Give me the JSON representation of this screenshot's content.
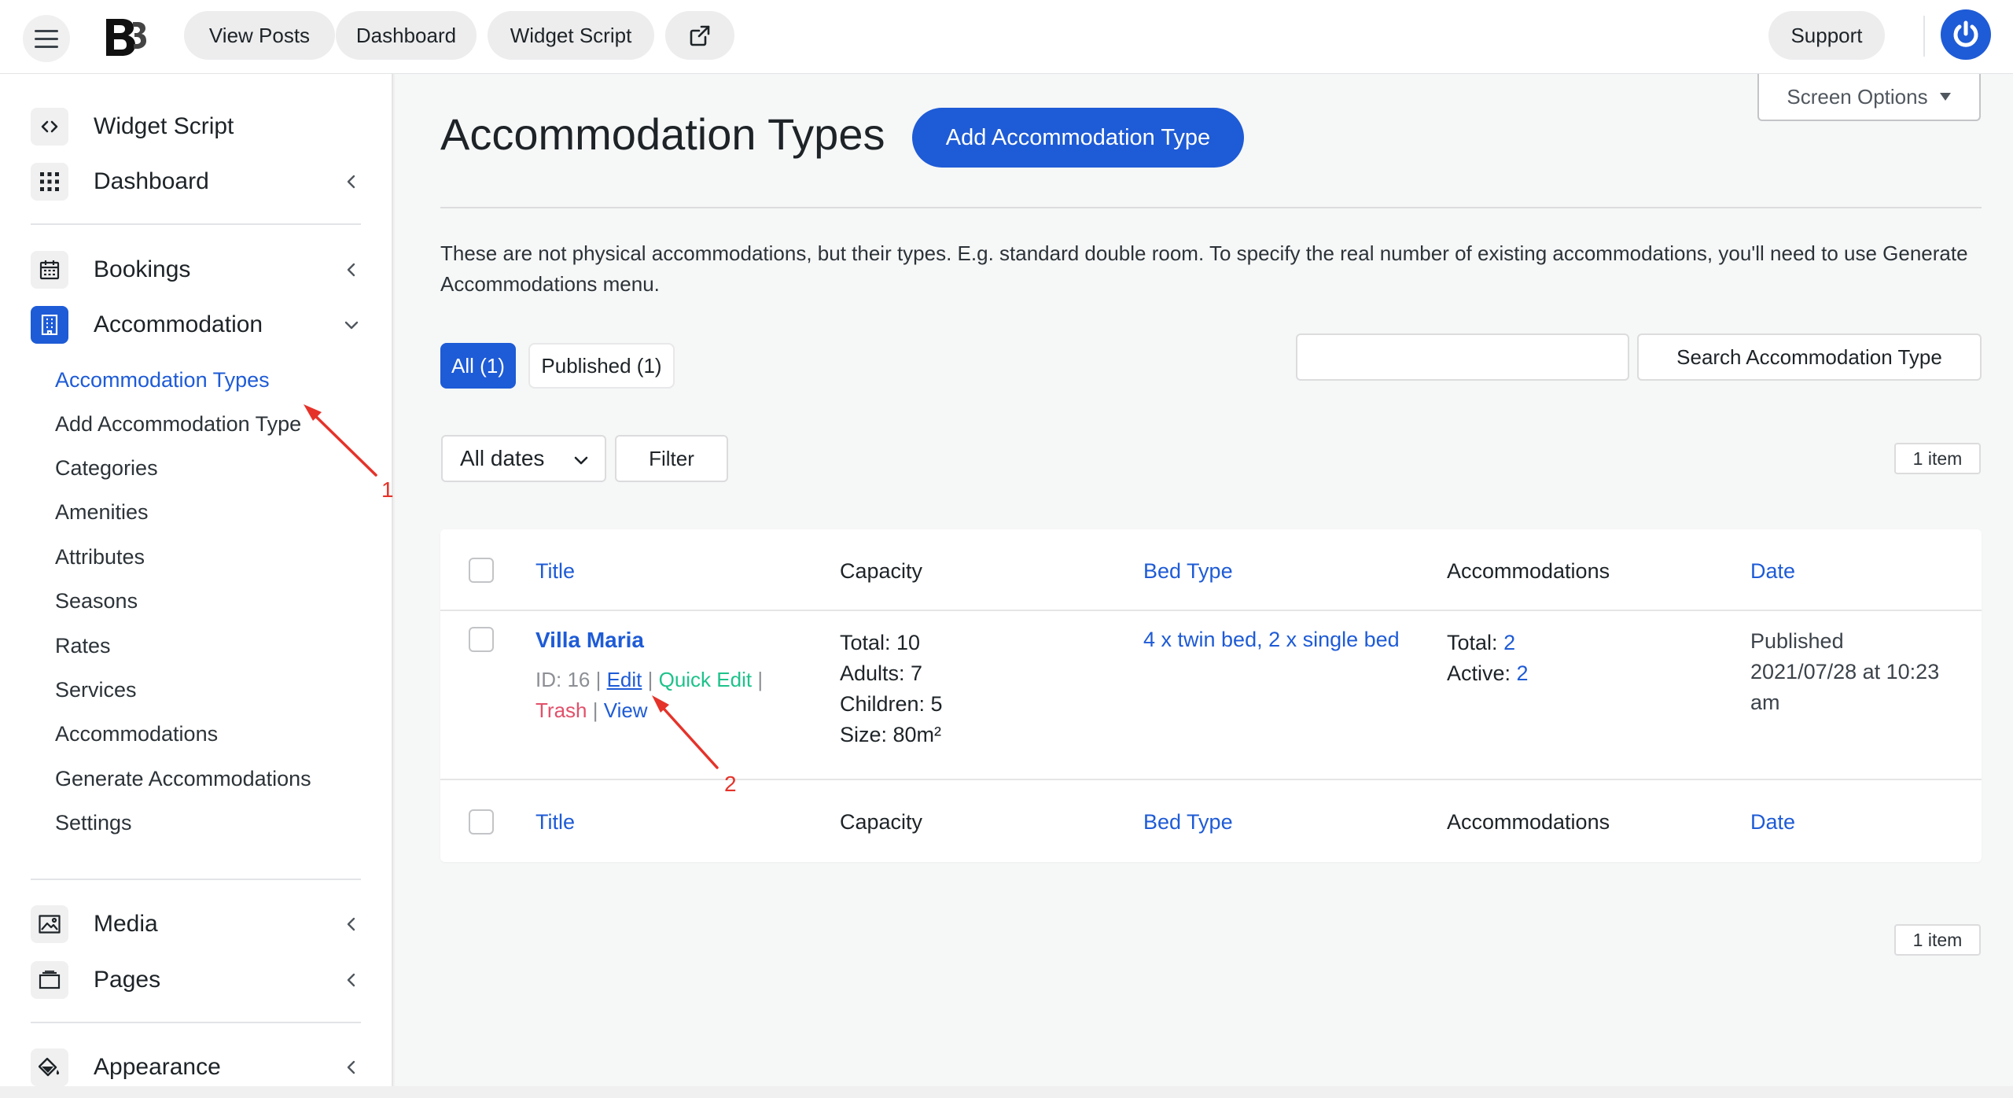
{
  "topbar": {
    "view_posts": "View Posts",
    "dashboard": "Dashboard",
    "widget_script": "Widget Script",
    "support": "Support",
    "accent_color": "#1e5bd6"
  },
  "sidebar": {
    "items": [
      {
        "label": "Widget Script",
        "icon": "code-icon"
      },
      {
        "label": "Dashboard",
        "icon": "grid-icon"
      },
      {
        "label": "Bookings",
        "icon": "calendar-icon"
      },
      {
        "label": "Accommodation",
        "icon": "building-icon"
      },
      {
        "label": "Media",
        "icon": "image-icon"
      },
      {
        "label": "Pages",
        "icon": "pages-icon"
      },
      {
        "label": "Appearance",
        "icon": "paint-bucket-icon"
      }
    ],
    "submenu": [
      "Accommodation Types",
      "Add Accommodation Type",
      "Categories",
      "Amenities",
      "Attributes",
      "Seasons",
      "Rates",
      "Services",
      "Accommodations",
      "Generate Accommodations",
      "Settings"
    ]
  },
  "main": {
    "screen_options": "Screen Options",
    "title": "Accommodation Types",
    "add_button": "Add Accommodation Type",
    "description": "These are not physical accommodations, but their types. E.g. standard double room. To specify the real number of existing accommodations, you'll need to use Generate Accommodations menu.",
    "tabs": {
      "all": "All (1)",
      "published": "Published (1)"
    },
    "search": {
      "placeholder": "",
      "button": "Search Accommodation Type"
    },
    "dates_select": "All dates",
    "filter_button": "Filter",
    "items_count": "1 item"
  },
  "table": {
    "columns": [
      "Title",
      "Capacity",
      "Bed Type",
      "Accommodations",
      "Date"
    ],
    "rows": [
      {
        "title": "Villa Maria",
        "id_label": "ID: 16",
        "actions": {
          "edit": "Edit",
          "quick_edit": "Quick Edit",
          "trash": "Trash",
          "view": "View"
        },
        "capacity": [
          "Total: 10",
          "Adults: 7",
          "Children: 5",
          "Size:  80m²"
        ],
        "bed_type": "4 x twin bed, 2 x single bed",
        "accommodations": {
          "total_label": "Total:",
          "total_value": "2",
          "active_label": "Active:",
          "active_value": "2"
        },
        "date": [
          "Published",
          "2021/07/28 at 10:23",
          "am"
        ]
      }
    ]
  },
  "annotations": [
    "1",
    "2"
  ]
}
